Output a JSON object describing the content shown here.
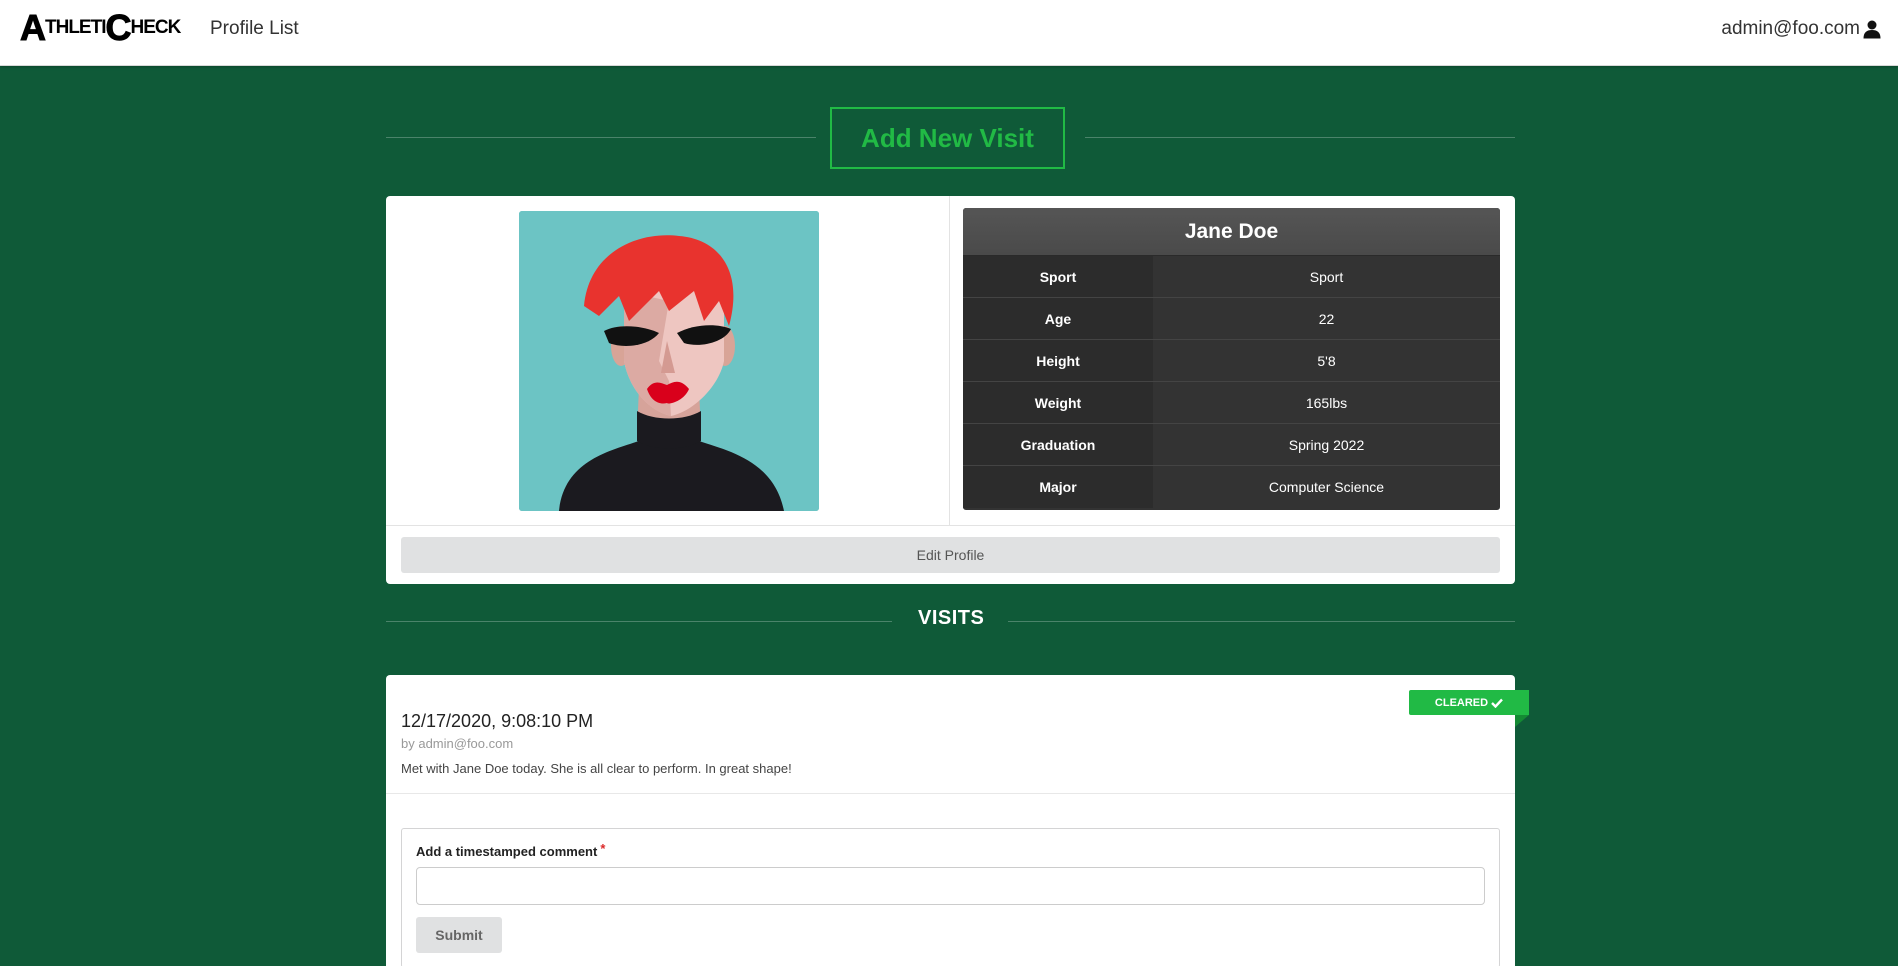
{
  "header": {
    "logo_first": "A",
    "logo_mid": "THLETI",
    "logo_second": "C",
    "logo_end": "HECK",
    "nav_profile_list": "Profile List",
    "user_email": "admin@foo.com"
  },
  "actions": {
    "add_visit_label": "Add New Visit",
    "edit_profile_label": "Edit Profile"
  },
  "profile": {
    "name": "Jane Doe",
    "fields": [
      {
        "label": "Sport",
        "value": "Sport"
      },
      {
        "label": "Age",
        "value": "22"
      },
      {
        "label": "Height",
        "value": "5'8"
      },
      {
        "label": "Weight",
        "value": "165lbs"
      },
      {
        "label": "Graduation",
        "value": "Spring 2022"
      },
      {
        "label": "Major",
        "value": "Computer Science"
      }
    ]
  },
  "visits": {
    "title": "VISITS",
    "items": [
      {
        "status": "CLEARED",
        "status_color": "#21ba45",
        "datetime": "12/17/2020, 9:08:10 PM",
        "author": "by admin@foo.com",
        "note": "Met with Jane Doe today. She is all clear to perform. In great shape!"
      }
    ],
    "comment_label": "Add a timestamped comment",
    "comment_required_mark": "*",
    "comment_value": "",
    "submit_label": "Submit"
  },
  "colors": {
    "background": "#0f5a38",
    "accent": "#21ba45"
  },
  "icons": {
    "user": "user-icon",
    "check": "check-icon"
  }
}
